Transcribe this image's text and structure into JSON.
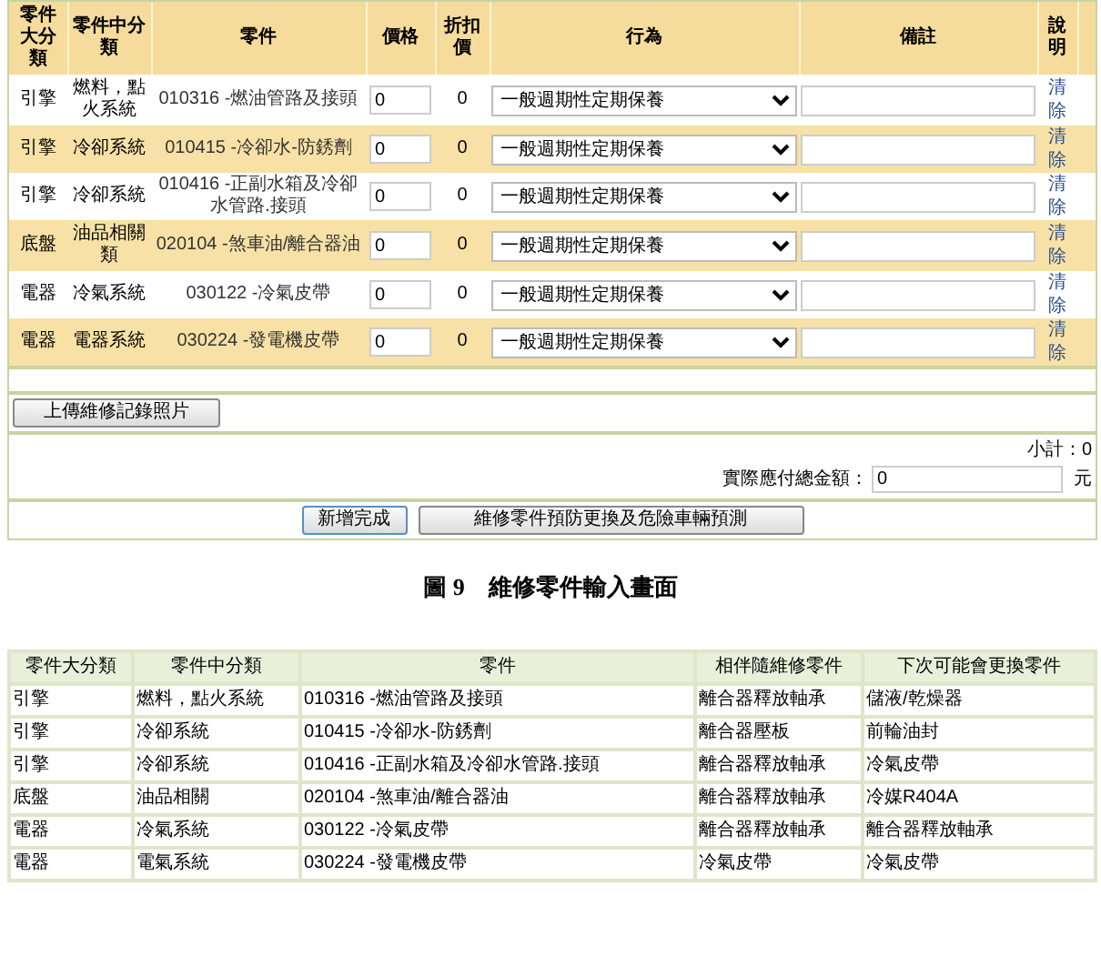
{
  "parts_form": {
    "columns": [
      "零件大分類",
      "零件中分類",
      "零件",
      "價格",
      "折扣價",
      "行為",
      "備註",
      "說明"
    ],
    "rows": [
      {
        "major": "引擎",
        "minor": "燃料，點火系統",
        "part": "010316 -燃油管路及接頭",
        "price": "0",
        "discount": "0",
        "action": "一般週期性定期保養",
        "clear": "清除"
      },
      {
        "major": "引擎",
        "minor": "冷卻系統",
        "part": "010415 -冷卻水-防銹劑",
        "price": "0",
        "discount": "0",
        "action": "一般週期性定期保養",
        "clear": "清除"
      },
      {
        "major": "引擎",
        "minor": "冷卻系統",
        "part": "010416 -正副水箱及冷卻水管路.接頭",
        "price": "0",
        "discount": "0",
        "action": "一般週期性定期保養",
        "clear": "清除"
      },
      {
        "major": "底盤",
        "minor": "油品相關類",
        "part": "020104 -煞車油/離合器油",
        "price": "0",
        "discount": "0",
        "action": "一般週期性定期保養",
        "clear": "清除"
      },
      {
        "major": "電器",
        "minor": "冷氣系統",
        "part": "030122 -冷氣皮帶",
        "price": "0",
        "discount": "0",
        "action": "一般週期性定期保養",
        "clear": "清除"
      },
      {
        "major": "電器",
        "minor": "電器系統",
        "part": "030224 -發電機皮帶",
        "price": "0",
        "discount": "0",
        "action": "一般週期性定期保養",
        "clear": "清除"
      }
    ],
    "upload_button": "上傳維修記錄照片",
    "subtotal": "小計：0",
    "total_label": "實際應付總金額：",
    "total_value": "0",
    "total_unit": "元",
    "buttons": [
      "新增完成",
      "維修零件預防更換及危險車輛預測"
    ]
  },
  "caption": "圖 9　維修零件輸入畫面",
  "prediction_table": {
    "columns": [
      "零件大分類",
      "零件中分類",
      "零件",
      "相伴隨維修零件",
      "下次可能會更換零件"
    ],
    "rows": [
      [
        "引擎",
        "燃料，點火系統",
        "010316 -燃油管路及接頭",
        "離合器釋放軸承",
        "儲液/乾燥器"
      ],
      [
        "引擎",
        "冷卻系統",
        "010415 -冷卻水-防銹劑",
        "離合器壓板",
        "前輪油封"
      ],
      [
        "引擎",
        "冷卻系統",
        "010416 -正副水箱及冷卻水管路.接頭",
        "離合器釋放軸承",
        "冷氣皮帶"
      ],
      [
        "底盤",
        "油品相關",
        "020104 -煞車油/離合器油",
        "離合器釋放軸承",
        "冷媒R404A"
      ],
      [
        "電器",
        "冷氣系統",
        "030122 -冷氣皮帶",
        "離合器釋放軸承",
        "離合器釋放軸承"
      ],
      [
        "電器",
        "電氣系統",
        "030224 -發電機皮帶",
        "冷氣皮帶",
        "冷氣皮帶"
      ]
    ]
  }
}
